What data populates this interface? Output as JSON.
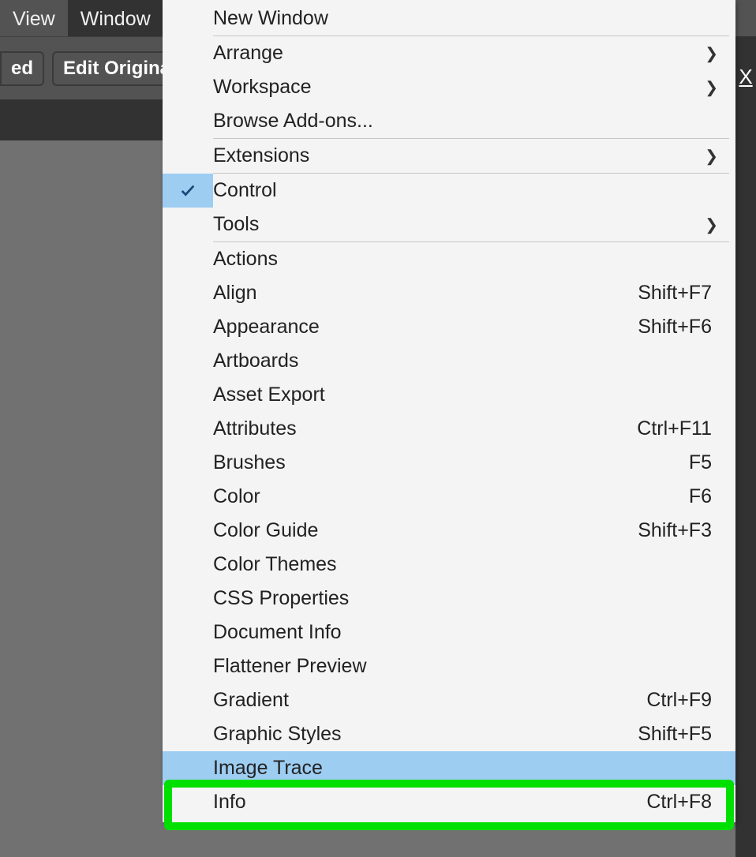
{
  "menubar": {
    "view": "View",
    "window": "Window"
  },
  "toolbar": {
    "cut_btn": "ed",
    "edit_original": "Edit Original"
  },
  "rightstrip": {
    "x": "X"
  },
  "menu": {
    "new_window": "New Window",
    "arrange": "Arrange",
    "workspace": "Workspace",
    "browse_addons": "Browse Add-ons...",
    "extensions": "Extensions",
    "control": "Control",
    "tools": "Tools",
    "actions": "Actions",
    "align": "Align",
    "align_sc": "Shift+F7",
    "appearance": "Appearance",
    "appearance_sc": "Shift+F6",
    "artboards": "Artboards",
    "asset_export": "Asset Export",
    "attributes": "Attributes",
    "attributes_sc": "Ctrl+F11",
    "brushes": "Brushes",
    "brushes_sc": "F5",
    "color": "Color",
    "color_sc": "F6",
    "color_guide": "Color Guide",
    "color_guide_sc": "Shift+F3",
    "color_themes": "Color Themes",
    "css_properties": "CSS Properties",
    "document_info": "Document Info",
    "flattener_preview": "Flattener Preview",
    "gradient": "Gradient",
    "gradient_sc": "Ctrl+F9",
    "graphic_styles": "Graphic Styles",
    "graphic_styles_sc": "Shift+F5",
    "image_trace": "Image Trace",
    "info": "Info",
    "info_sc": "Ctrl+F8"
  }
}
